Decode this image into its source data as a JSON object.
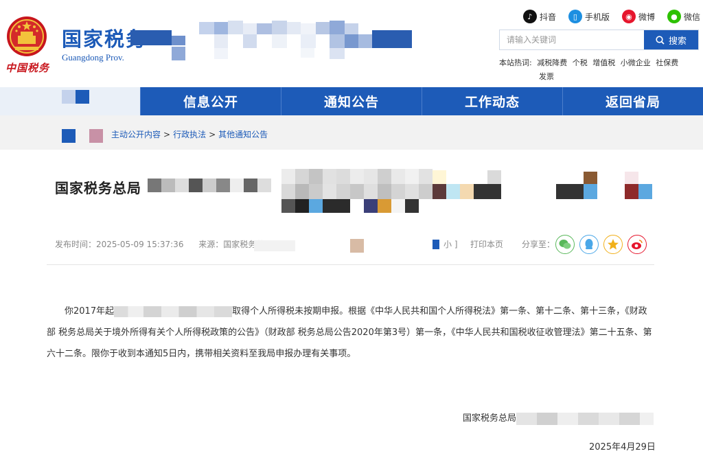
{
  "header": {
    "logo_script": "中国税务",
    "site_title": "国家税务",
    "site_subtitle": "Guangdong Prov.",
    "social": [
      {
        "label": "抖音",
        "icon": "douyin-icon",
        "color": "#111111"
      },
      {
        "label": "手机版",
        "icon": "mobile-icon",
        "color": "#1d8fe1"
      },
      {
        "label": "微博",
        "icon": "weibo-icon",
        "color": "#e6162d"
      },
      {
        "label": "微信",
        "icon": "wechat-icon",
        "color": "#2dc100"
      }
    ],
    "search": {
      "placeholder": "请输入关键词",
      "button_label": "搜索"
    },
    "hotwords": {
      "label": "本站热词:",
      "items": [
        "减税降费",
        "个税",
        "增值税",
        "小微企业",
        "社保费",
        "发票"
      ]
    }
  },
  "nav": {
    "items": [
      "",
      "信息公开",
      "通知公告",
      "工作动态",
      "返回省局"
    ]
  },
  "breadcrumb": {
    "items": [
      "主动公开内容",
      "行政执法",
      "其他通知公告"
    ],
    "separator": ">"
  },
  "article": {
    "title_prefix": "国家税务总局",
    "meta": {
      "publish_time": "发布时间：2025-05-09 15:37:36",
      "source": "来源：国家税务总"
    },
    "font_tool_tail": "小 ]",
    "print_label": "打印本页",
    "share_label": "分享至：",
    "body_start": "你2017年起",
    "body_rest": "取得个人所得税未按期申报。根据《中华人民共和国个人所得税法》第一条、第十二条、第十三条，《财政部 税务总局关于境外所得有关个人所得税政策的公告》（财政部 税务总局公告2020年第3号）第一条，《中华人民共和国税收征收管理法》第二十五条、第六十二条。限你于收到本通知5日内，携带相关资料至我局申报办理有关事项。",
    "sign_org": "国家税务总局",
    "sign_date": "2025年4月29日"
  },
  "colors": {
    "brand_blue": "#1d5bb8",
    "nav_bg": "#1d5bb8"
  }
}
